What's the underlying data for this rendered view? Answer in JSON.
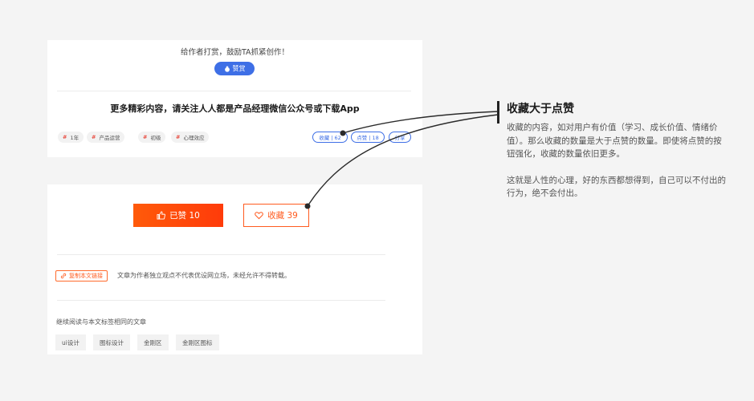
{
  "top_card": {
    "reward_text": "给作者打赏，鼓励TA抓紧创作！",
    "reward_button": "赞赏",
    "promo_text": "更多精彩内容，请关注人人都是产品经理微信公众号或下载App",
    "tags": [
      {
        "hash": "#",
        "label": "1年"
      },
      {
        "hash": "#",
        "label": "产品运营"
      },
      {
        "hash": "#",
        "label": "初级"
      },
      {
        "hash": "#",
        "label": "心理效应"
      }
    ],
    "pills": [
      "收藏 | 62",
      "点赞 | 18",
      "分享"
    ]
  },
  "bottom_card": {
    "like_label": "已赞 10",
    "fav_label": "收藏 39",
    "copy_label": "复制本文链接",
    "disclaimer": "文章为作者独立观点不代表优设网立场，未经允许不得转载。",
    "related_title": "继续阅读与本文标签相同的文章",
    "related_tags": [
      "ui设计",
      "图标设计",
      "金刚区",
      "金刚区图标"
    ]
  },
  "annotation": {
    "title": "收藏大于点赞",
    "paragraph1": "收藏的内容，如对用户有价值（学习、成长价值、情绪价值）。那么收藏的数量是大于点赞的数量。即使将点赞的按钮强化，收藏的数量依旧更多。",
    "paragraph2": "这就是人性的心理，好的东西都想得到，自己可以不付出的行为，绝不会付出。"
  },
  "colors": {
    "accent_blue": "#3e6fe6",
    "accent_orange": "#ff5b1f",
    "background": "#f4f4f4"
  },
  "icons": [
    "coin-icon",
    "thumbs-up-icon",
    "heart-icon",
    "link-icon"
  ]
}
